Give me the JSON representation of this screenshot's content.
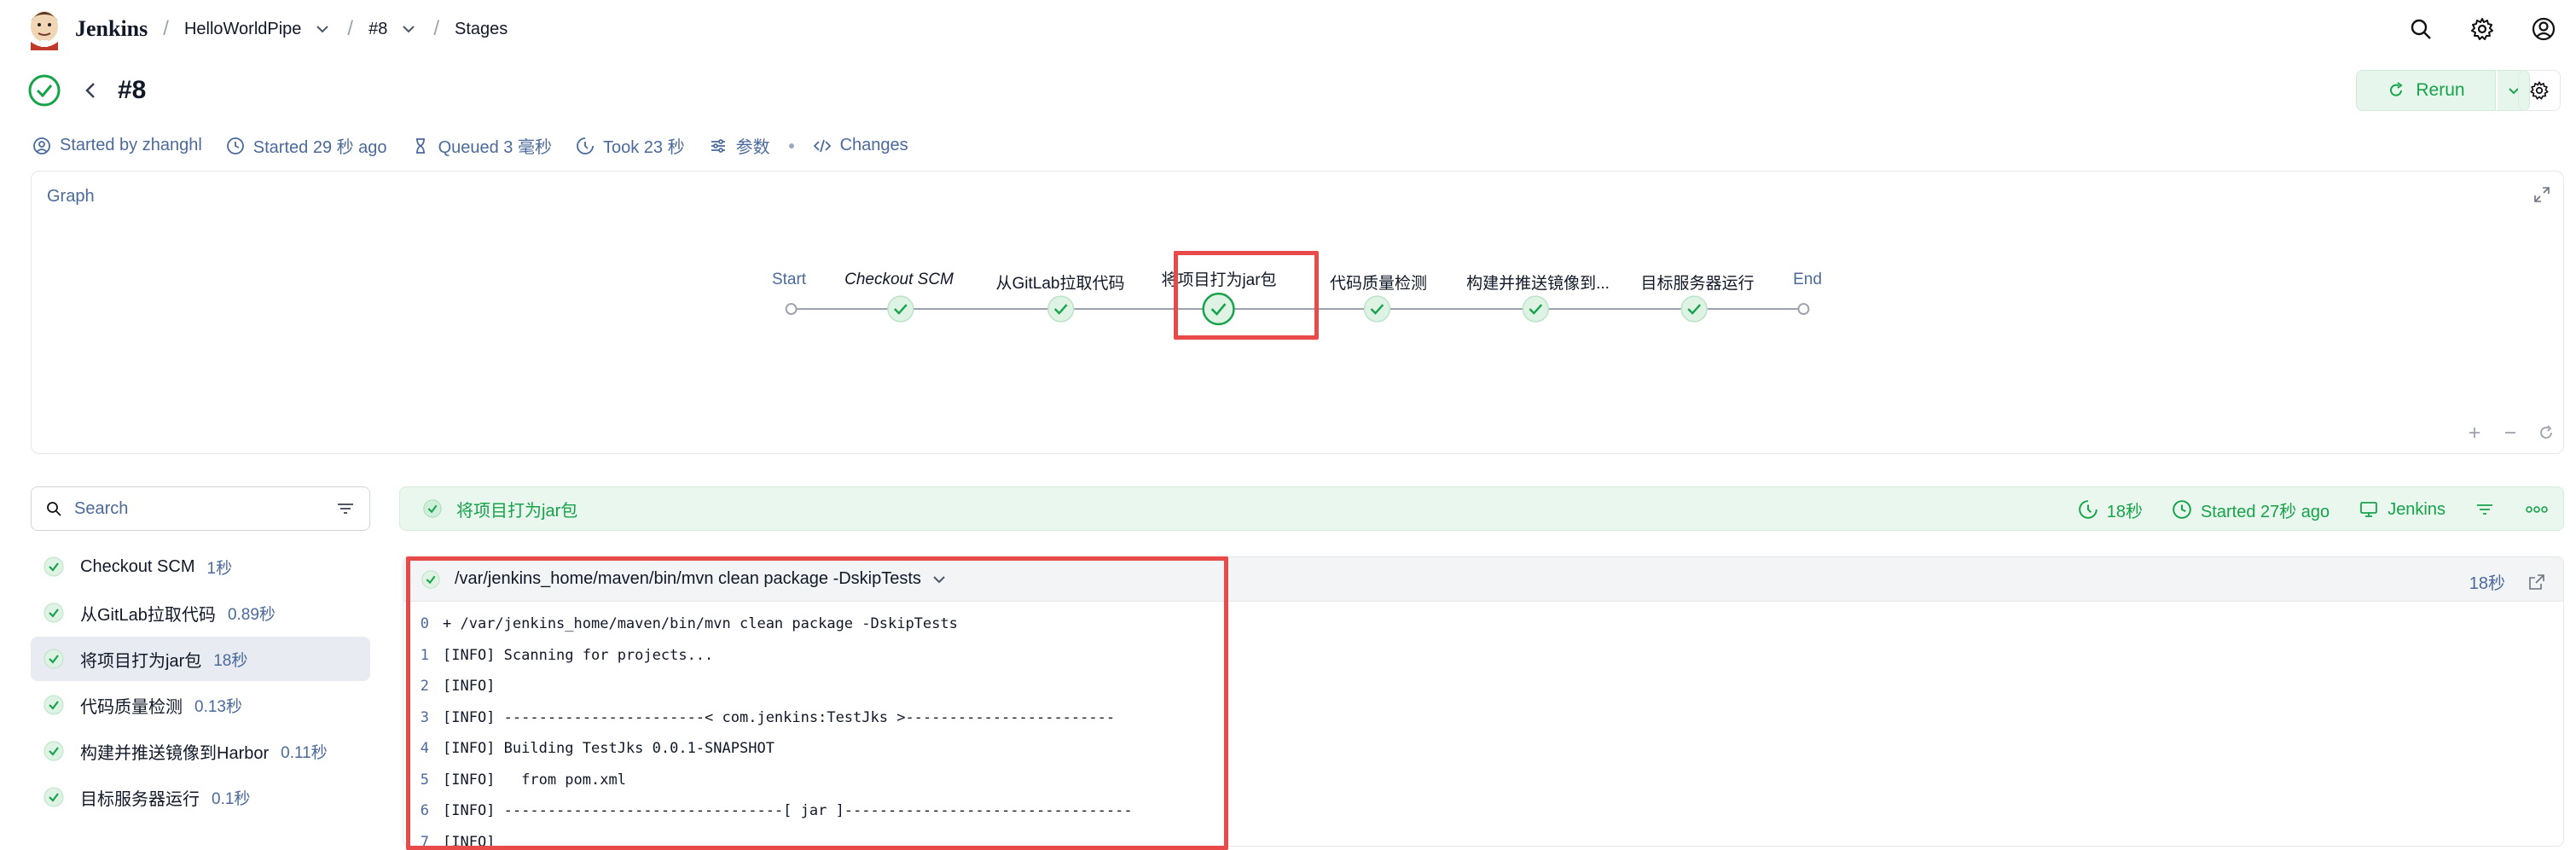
{
  "header": {
    "brand": "Jenkins",
    "breadcrumbs": [
      {
        "label": "HelloWorldPipe",
        "dropdown": true
      },
      {
        "label": "#8",
        "dropdown": true
      },
      {
        "label": "Stages",
        "dropdown": false
      }
    ],
    "icons": [
      "search-icon",
      "gear-icon",
      "user-icon"
    ]
  },
  "build": {
    "number": "#8",
    "status": "success",
    "rerun_label": "Rerun",
    "meta": {
      "started_by": "Started by zhanghl",
      "started": "Started 29 秒 ago",
      "queued": "Queued 3 毫秒",
      "took": "Took 23 秒",
      "params": "参数",
      "changes": "Changes"
    }
  },
  "graph": {
    "title": "Graph",
    "nodes": [
      {
        "label": "Start",
        "type": "endpoint"
      },
      {
        "label": "Checkout SCM",
        "type": "stage",
        "italic": true
      },
      {
        "label": "从GitLab拉取代码",
        "type": "stage"
      },
      {
        "label": "将项目打为jar包",
        "type": "stage",
        "selected": true
      },
      {
        "label": "代码质量检测",
        "type": "stage"
      },
      {
        "label": "构建并推送镜像到...",
        "type": "stage"
      },
      {
        "label": "目标服务器运行",
        "type": "stage"
      },
      {
        "label": "End",
        "type": "endpoint"
      }
    ]
  },
  "sidebar": {
    "search_placeholder": "Search",
    "stages": [
      {
        "name": "Checkout SCM",
        "duration": "1秒",
        "active": false
      },
      {
        "name": "从GitLab拉取代码",
        "duration": "0.89秒",
        "active": false
      },
      {
        "name": "将项目打为jar包",
        "duration": "18秒",
        "active": true
      },
      {
        "name": "代码质量检测",
        "duration": "0.13秒",
        "active": false
      },
      {
        "name": "构建并推送镜像到Harbor",
        "duration": "0.11秒",
        "active": false
      },
      {
        "name": "目标服务器运行",
        "duration": "0.1秒",
        "active": false
      }
    ]
  },
  "stage_detail": {
    "name": "将项目打为jar包",
    "duration": "18秒",
    "started": "Started 27秒 ago",
    "agent": "Jenkins"
  },
  "log": {
    "step_command": "/var/jenkins_home/maven/bin/mvn clean package -DskipTests",
    "step_duration": "18秒",
    "lines": [
      {
        "n": "0",
        "text": "+ /var/jenkins_home/maven/bin/mvn clean package -DskipTests"
      },
      {
        "n": "1",
        "text": "[INFO] Scanning for projects..."
      },
      {
        "n": "2",
        "text": "[INFO]"
      },
      {
        "n": "3",
        "text": "[INFO] -----------------------< com.jenkins:TestJks >------------------------"
      },
      {
        "n": "4",
        "text": "[INFO] Building TestJks 0.0.1-SNAPSHOT"
      },
      {
        "n": "5",
        "text": "[INFO]   from pom.xml"
      },
      {
        "n": "6",
        "text": "[INFO] --------------------------------[ jar ]---------------------------------"
      },
      {
        "n": "7",
        "text": "[INFO]"
      }
    ]
  },
  "colors": {
    "success": "#16a34a",
    "success_bg": "#e7f6ec",
    "highlight": "#e84a4a",
    "muted_text": "#4b6a9b"
  }
}
